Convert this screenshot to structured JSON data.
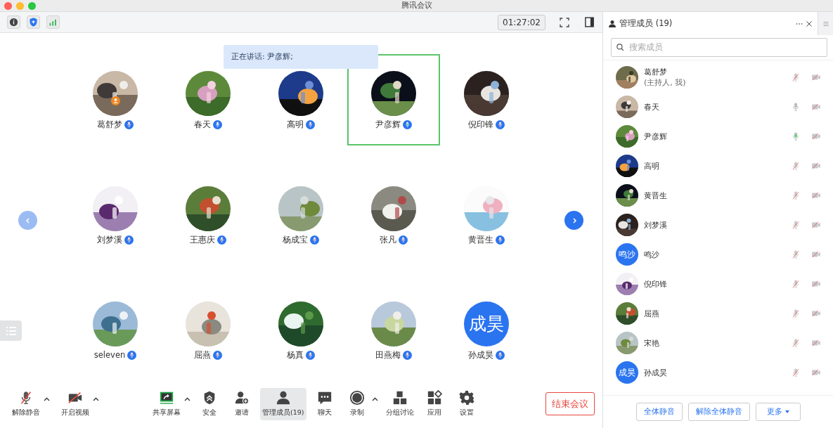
{
  "window": {
    "title": "腾讯会议"
  },
  "top_bar": {
    "timer": "01:27:02"
  },
  "speaking_banner": "正在讲话: 尹彦辉;",
  "pager": {
    "prev_enabled": false,
    "next_enabled": true
  },
  "tiles": [
    {
      "name": "葛舒梦",
      "muted": true,
      "speaking": false,
      "host": true,
      "active_speaker": false
    },
    {
      "name": "春天",
      "muted": false,
      "speaking": false,
      "host": false,
      "active_speaker": false
    },
    {
      "name": "高明",
      "muted": true,
      "speaking": false,
      "host": false,
      "active_speaker": false
    },
    {
      "name": "尹彦辉",
      "muted": false,
      "speaking": true,
      "host": false,
      "active_speaker": true
    },
    {
      "name": "倪印锋",
      "muted": true,
      "speaking": false,
      "host": false,
      "active_speaker": false
    },
    {
      "name": "刘梦溪",
      "muted": true,
      "speaking": false,
      "host": false,
      "active_speaker": false
    },
    {
      "name": "王惠庆",
      "muted": true,
      "speaking": false,
      "host": false,
      "active_speaker": false
    },
    {
      "name": "杨成宝",
      "muted": true,
      "speaking": false,
      "host": false,
      "active_speaker": false
    },
    {
      "name": "张凡",
      "muted": true,
      "speaking": false,
      "host": false,
      "active_speaker": false
    },
    {
      "name": "黄晋生",
      "muted": true,
      "speaking": false,
      "host": false,
      "active_speaker": false
    },
    {
      "name": "seleven",
      "muted": true,
      "speaking": false,
      "host": false,
      "active_speaker": false
    },
    {
      "name": "屈燕",
      "muted": true,
      "speaking": false,
      "host": false,
      "active_speaker": false
    },
    {
      "name": "杨真",
      "muted": true,
      "speaking": false,
      "host": false,
      "active_speaker": false
    },
    {
      "name": "田燕梅",
      "muted": true,
      "speaking": false,
      "host": false,
      "active_speaker": false
    },
    {
      "name": "孙成昊",
      "avatar": {
        "kind": "initials",
        "text": "成昊"
      },
      "muted": true,
      "speaking": false,
      "host": false,
      "active_speaker": false
    }
  ],
  "toolbar": [
    {
      "label": "解除静音",
      "kind": "mic-off",
      "caret": true,
      "selected": false
    },
    {
      "label": "开启视频",
      "kind": "video-off",
      "caret": true,
      "selected": false
    },
    {
      "label": "共享屏幕",
      "kind": "share",
      "caret": true,
      "selected": false
    },
    {
      "label": "安全",
      "kind": "shield",
      "caret": false,
      "selected": false
    },
    {
      "label": "邀请",
      "kind": "invite",
      "caret": false,
      "selected": false
    },
    {
      "label": "管理成员(19)",
      "kind": "members",
      "caret": false,
      "selected": true
    },
    {
      "label": "聊天",
      "kind": "chat",
      "caret": false,
      "selected": false
    },
    {
      "label": "录制",
      "kind": "record",
      "caret": true,
      "selected": false
    },
    {
      "label": "分组讨论",
      "kind": "groups",
      "caret": false,
      "selected": false
    },
    {
      "label": "应用",
      "kind": "apps",
      "caret": false,
      "selected": false
    },
    {
      "label": "设置",
      "kind": "settings",
      "caret": false,
      "selected": false
    }
  ],
  "end_button": "结束会议",
  "panel": {
    "title": "管理成员 (19)",
    "search": {
      "placeholder": "搜索成员"
    },
    "members": [
      {
        "name": "葛舒梦",
        "note": "(主持人, 我)",
        "muted": true,
        "speaking": false,
        "video_on": false
      },
      {
        "name": "春天",
        "muted": false,
        "speaking": false,
        "video_on": false
      },
      {
        "name": "尹彦辉",
        "muted": false,
        "speaking": true,
        "video_on": false
      },
      {
        "name": "高明",
        "muted": true,
        "speaking": false,
        "video_on": false
      },
      {
        "name": "黄晋生",
        "muted": true,
        "speaking": false,
        "video_on": false
      },
      {
        "name": "刘梦溪",
        "muted": true,
        "speaking": false,
        "video_on": false
      },
      {
        "name": "鸣沙",
        "avatar": {
          "kind": "initials",
          "text": "鸣沙"
        },
        "muted": true,
        "speaking": false,
        "video_on": false
      },
      {
        "name": "倪印锋",
        "muted": true,
        "speaking": false,
        "video_on": false
      },
      {
        "name": "屈燕",
        "muted": true,
        "speaking": false,
        "video_on": false
      },
      {
        "name": "宋艳",
        "muted": true,
        "speaking": false,
        "video_on": false
      },
      {
        "name": "孙成昊",
        "avatar": {
          "kind": "initials",
          "text": "成昊"
        },
        "muted": true,
        "speaking": false,
        "video_on": false
      }
    ],
    "footer_buttons": [
      {
        "label": "全体静音",
        "dropdown": false
      },
      {
        "label": "解除全体静音",
        "dropdown": false
      },
      {
        "label": "更多",
        "dropdown": true
      }
    ]
  }
}
